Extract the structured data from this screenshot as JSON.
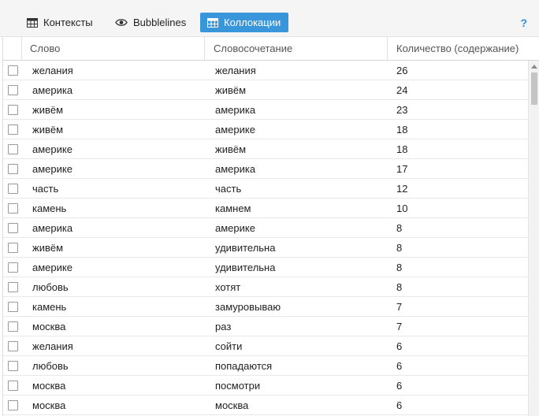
{
  "toolbar": {
    "tabs": [
      {
        "label": "Контексты",
        "icon": "table-icon",
        "active": false
      },
      {
        "label": "Bubblelines",
        "icon": "eye-icon",
        "active": false
      },
      {
        "label": "Коллокации",
        "icon": "table-icon",
        "active": true
      }
    ],
    "help_label": "?"
  },
  "colors": {
    "accent": "#3a96db",
    "help": "#2f8bd6"
  },
  "table": {
    "columns": [
      "Слово",
      "Словосочетание",
      "Количество (содержание)"
    ],
    "rows": [
      [
        "желания",
        "желания",
        "26"
      ],
      [
        "америка",
        "живём",
        "24"
      ],
      [
        "живём",
        "америка",
        "23"
      ],
      [
        "живём",
        "америке",
        "18"
      ],
      [
        "америке",
        "живём",
        "18"
      ],
      [
        "америке",
        "америка",
        "17"
      ],
      [
        "часть",
        "часть",
        "12"
      ],
      [
        "камень",
        "камнем",
        "10"
      ],
      [
        "америка",
        "америке",
        "8"
      ],
      [
        "живём",
        "удивительна",
        "8"
      ],
      [
        "америке",
        "удивительна",
        "8"
      ],
      [
        "любовь",
        "хотят",
        "8"
      ],
      [
        "камень",
        "замуровываю",
        "7"
      ],
      [
        "москва",
        "раз",
        "7"
      ],
      [
        "желания",
        "сойти",
        "6"
      ],
      [
        "любовь",
        "попадаются",
        "6"
      ],
      [
        "москва",
        "посмотри",
        "6"
      ],
      [
        "москва",
        "москва",
        "6"
      ]
    ]
  }
}
